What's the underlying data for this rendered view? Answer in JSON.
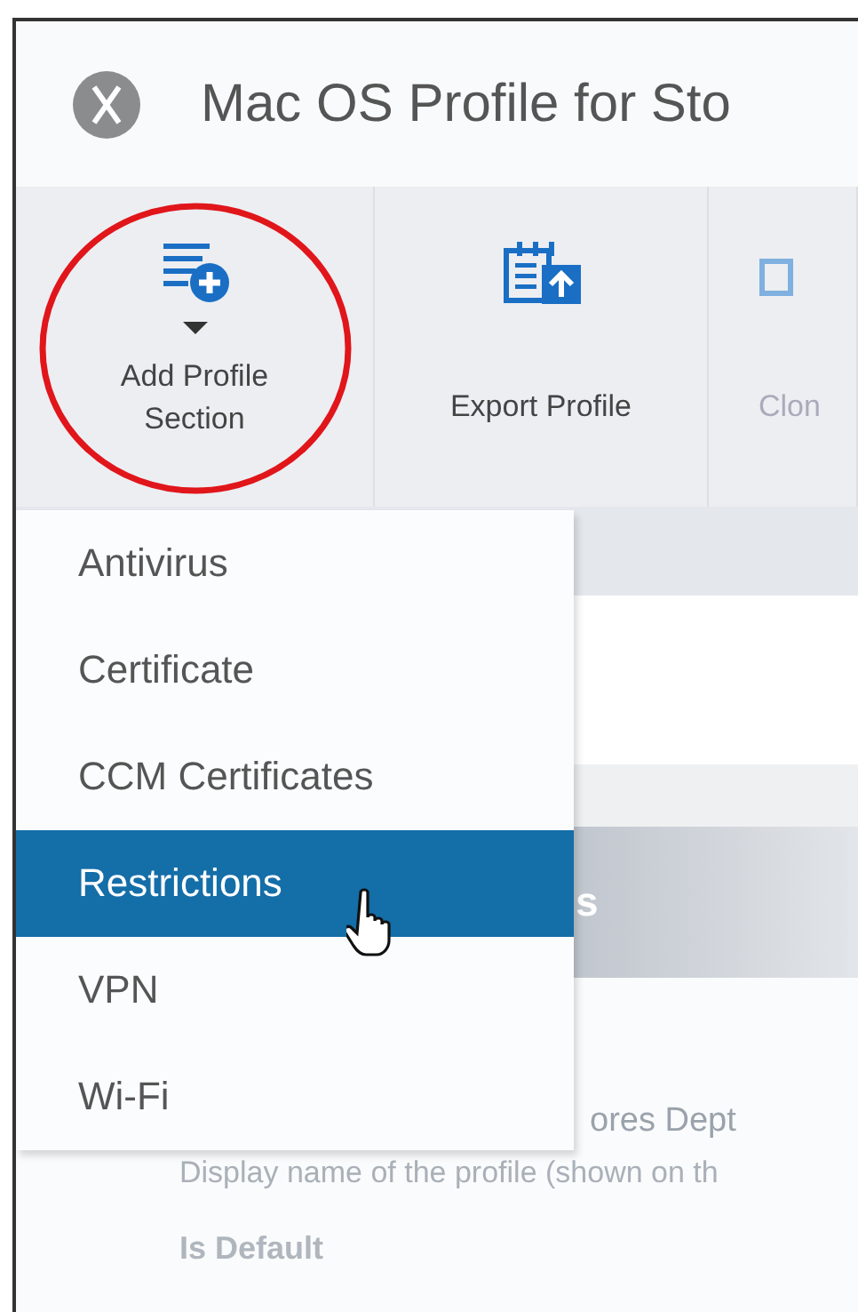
{
  "window": {
    "title": "Mac OS Profile for Sto"
  },
  "toolbar": [
    {
      "label": "Add Profile Section",
      "kind": "add-section",
      "circled": true
    },
    {
      "label": "Export Profile",
      "kind": "export",
      "circled": false
    },
    {
      "label": "Clon",
      "kind": "clone",
      "circled": false
    }
  ],
  "menu": [
    {
      "label": "Antivirus",
      "selected": false
    },
    {
      "label": "Certificate",
      "selected": false
    },
    {
      "label": "CCM Certificates",
      "selected": false
    },
    {
      "label": "Restrictions",
      "selected": true
    },
    {
      "label": "VPN",
      "selected": false
    },
    {
      "label": "Wi-Fi",
      "selected": false
    }
  ],
  "form": {
    "header": "s",
    "rows": [
      {
        "kind": "value",
        "text": "ores Dept"
      },
      {
        "kind": "hint",
        "text": "Display name of the profile (shown on th"
      },
      {
        "kind": "label",
        "text": "Is Default"
      }
    ]
  }
}
